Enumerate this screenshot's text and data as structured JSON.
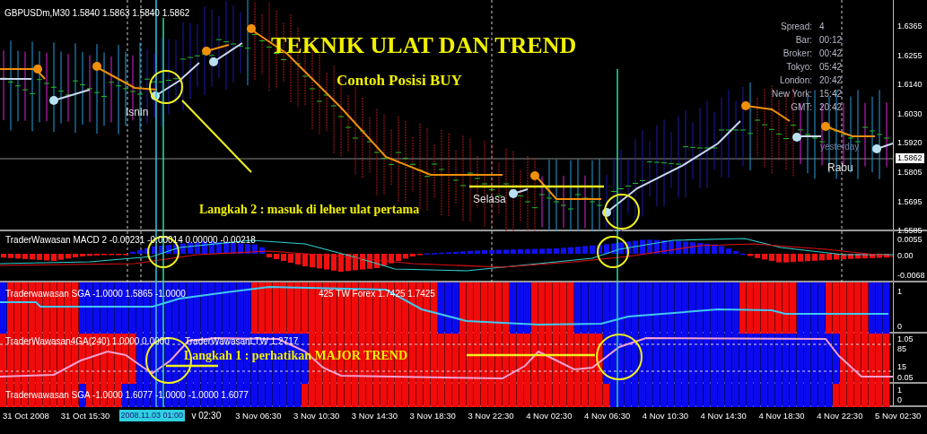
{
  "main_chart": {
    "title": "GBPUSDm,M30  1.5840 1.5863 1.5840 1.5862",
    "headline": "TEKNIK ULAT DAN TREND",
    "subheadline": "Contoh Posisi BUY",
    "step_note": "Langkah  2 : masuk di leher ulat pertama",
    "day_labels": [
      {
        "text": "Isnin",
        "kind": "day"
      },
      {
        "text": "Selasa",
        "kind": "day"
      },
      {
        "text": "yesterday",
        "kind": "faint"
      },
      {
        "text": "Rabu",
        "kind": "day"
      }
    ],
    "info": [
      {
        "label": "Spread:",
        "value": "4"
      },
      {
        "label": "Bar:",
        "value": "00:12"
      },
      {
        "label": "Broker:",
        "value": "00:42"
      },
      {
        "label": "Tokyo:",
        "value": "05:42"
      },
      {
        "label": "London:",
        "value": "20:42"
      },
      {
        "label": "New York:",
        "value": "15:42"
      },
      {
        "label": "GMT:",
        "value": "20:42"
      }
    ],
    "price_axis": [
      "1.6365",
      "1.6255",
      "1.6140",
      "1.6030",
      "1.5920",
      "1.5805",
      "1.5695",
      "1.5585"
    ],
    "current_price": "1.5862"
  },
  "macd_panel": {
    "label": "TraderWawasan MACD 2 -0.00231 -0.00014 0.00000 -0.00218",
    "axis": [
      "0.0055",
      "0.00",
      "-0.0068"
    ]
  },
  "sga_panel": {
    "labels": [
      "Traderwawasan SGA -1.0000 1.5865 -1.0000",
      "425  TW Forex 1.7425 1.7425"
    ],
    "axis": [
      "1",
      "0"
    ]
  },
  "trend_panel": {
    "labels": [
      "TraderWawasan4GA(240) 1.0000 0.0000",
      "TraderWawasanLTW 1.2717"
    ],
    "step_note": "Langkah 1 : perhatikan MAJOR TREND",
    "axis": [
      "1.05",
      "85",
      "15",
      "0.05"
    ]
  },
  "sga_panel_2": {
    "label": "Traderwawasan SGA -1.0000 1.6077 -1.0000 -1.0000 1.6077",
    "axis": [
      "1",
      "0"
    ]
  },
  "time_axis": {
    "labels": [
      {
        "text": "31 Oct 2008",
        "kind": "tick"
      },
      {
        "text": "31 Oct 15:30",
        "kind": "tick"
      },
      {
        "text": "2008.11.03 01:00",
        "kind": "cursor"
      },
      {
        "text": "v 02:30",
        "kind": "partial"
      },
      {
        "text": "3 Nov 06:30",
        "kind": "tick"
      },
      {
        "text": "3 Nov 10:30",
        "kind": "tick"
      },
      {
        "text": "3 Nov 14:30",
        "kind": "tick"
      },
      {
        "text": "3 Nov 18:30",
        "kind": "tick"
      },
      {
        "text": "3 Nov 22:30",
        "kind": "tick"
      },
      {
        "text": "4 Nov 02:30",
        "kind": "tick"
      },
      {
        "text": "4 Nov 06:30",
        "kind": "tick"
      },
      {
        "text": "4 Nov 10:30",
        "kind": "tick"
      },
      {
        "text": "4 Nov 14:30",
        "kind": "tick"
      },
      {
        "text": "4 Nov 18:30",
        "kind": "tick"
      },
      {
        "text": "4 Nov 22:30",
        "kind": "tick"
      },
      {
        "text": "5 Nov 02:30",
        "kind": "tick"
      }
    ]
  }
}
